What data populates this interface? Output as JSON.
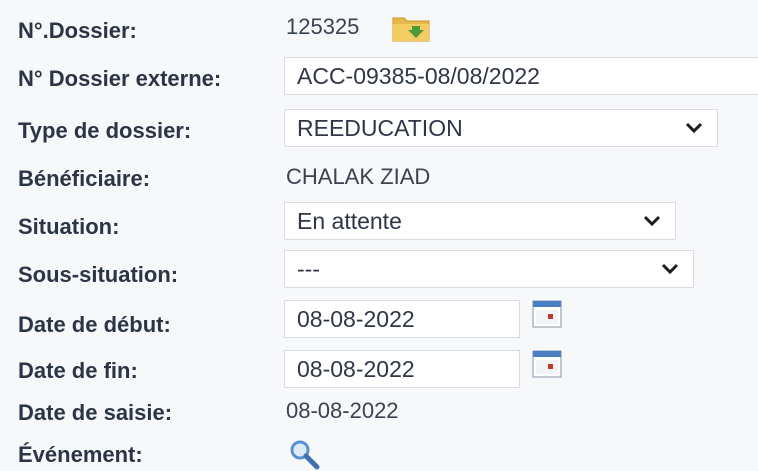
{
  "fields": {
    "dossier_no": {
      "label": "N°.Dossier:",
      "value": "125325",
      "icon": "folder-icon"
    },
    "dossier_externe": {
      "label": "N° Dossier externe:",
      "value": "ACC-09385-08/08/2022"
    },
    "type_dossier": {
      "label": "Type de dossier:",
      "selected": "REEDUCATION"
    },
    "beneficiaire": {
      "label": "Bénéficiaire:",
      "value": "CHALAK ZIAD"
    },
    "situation": {
      "label": "Situation:",
      "selected": "En attente"
    },
    "sous_situation": {
      "label": "Sous-situation:",
      "selected": "---"
    },
    "date_debut": {
      "label": "Date de début:",
      "value": "08-08-2022",
      "icon": "calendar-icon"
    },
    "date_fin": {
      "label": "Date de fin:",
      "value": "08-08-2022",
      "icon": "calendar-icon"
    },
    "date_saisie": {
      "label": "Date de saisie:",
      "value": "08-08-2022"
    },
    "evenement": {
      "label": "Événement:",
      "icon": "magnifier-icon"
    }
  },
  "colors": {
    "label": "#2c3546",
    "background": "#f7f8fa",
    "folder": "#e8b84a",
    "folder_arrow": "#4a9a3a",
    "calendar_header": "#4b7fc4",
    "calendar_dot": "#c0392b",
    "magnifier": "#5b8fd1"
  }
}
